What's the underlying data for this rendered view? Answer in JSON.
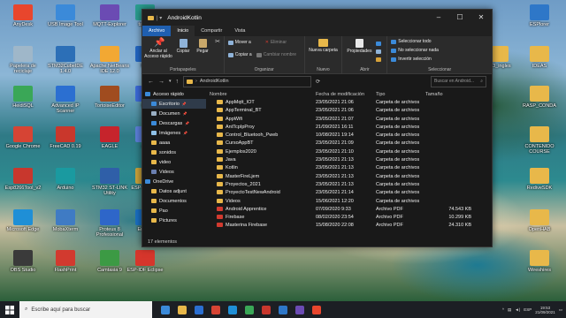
{
  "desktop": {
    "icons": [
      {
        "label": "AnyDesk",
        "color": "#e8462d"
      },
      {
        "label": "USB Image Tool",
        "color": "#3b8ad9"
      },
      {
        "label": "MQTT-Explorer",
        "color": "#6b4bb3"
      },
      {
        "label": "tasmo",
        "color": "#2a9d8f"
      },
      {
        "label": "Papelera de reciclaje",
        "color": "#9fb7c9"
      },
      {
        "label": "STM32CubeIDE 1.4.0",
        "color": "#2c6fb7"
      },
      {
        "label": "Apache NetBeans IDE 12.0",
        "color": "#f2a833"
      },
      {
        "label": "Mic",
        "color": "#2367c4"
      },
      {
        "label": "HeidiSQL",
        "color": "#3aa757"
      },
      {
        "label": "Advanced IP Scanner",
        "color": "#2b6fd1"
      },
      {
        "label": "TortoiseEditor",
        "color": "#a04c1f"
      },
      {
        "label": "CC",
        "color": "#3b6ad9"
      },
      {
        "label": "Google Chrome",
        "color": "#d64434"
      },
      {
        "label": "FreeCAD 0.19",
        "color": "#c9372c"
      },
      {
        "label": "EAGLE",
        "color": "#c6242c"
      },
      {
        "label": "AC",
        "color": "#5b7fd8"
      },
      {
        "label": "Esp8266Tool_v2",
        "color": "#c8372d"
      },
      {
        "label": "Arduino",
        "color": "#1a9aa0"
      },
      {
        "label": "STM32 ST-LINK Utility",
        "color": "#2f5fa8"
      },
      {
        "label": "ESP-Downlo",
        "color": "#c9a23a"
      },
      {
        "label": "Microsoft Edge",
        "color": "#1f8fd6"
      },
      {
        "label": "MobaXterm",
        "color": "#3f7bc4"
      },
      {
        "label": "Proteus 8 Professional",
        "color": "#2e66c9"
      },
      {
        "label": "Ensam",
        "color": "#1a6fc2"
      },
      {
        "label": "OBS Studio",
        "color": "#3a3a3a"
      },
      {
        "label": "FlashPrint",
        "color": "#d23a2f"
      },
      {
        "label": "Camtasia 9",
        "color": "#3c9a44"
      },
      {
        "label": "ESP-IDF Eclipse",
        "color": "#d6362c"
      },
      {
        "label": "ESPlorer",
        "color": "#2e77c8"
      },
      {
        "label": "Ap3_ingles",
        "color": "#e8b84a"
      },
      {
        "label": "IDEAS",
        "color": "#e8b84a"
      },
      {
        "label": "RASP_CONDA",
        "color": "#e8b84a"
      },
      {
        "label": "CONTENIDO COURSE",
        "color": "#e8b84a"
      },
      {
        "label": "RediveSDK",
        "color": "#e8b84a"
      },
      {
        "label": "OpenHAB",
        "color": "#e8b84a"
      },
      {
        "label": "Wireshires",
        "color": "#e8b84a"
      }
    ]
  },
  "window": {
    "title": "AndroidKotlin",
    "tabs": [
      "Archivo",
      "Inicio",
      "Compartir",
      "Vista"
    ],
    "ribbon": {
      "pin_label": "Anclar al Acceso rápido",
      "copy_label": "Copiar",
      "paste_label": "Pegar",
      "cut_label": "",
      "group_portapapeles": "Portapapeles",
      "move_to": "Mover a",
      "copy_to": "Copiar a",
      "delete": "Eliminar",
      "rename": "Cambiar nombre",
      "group_organizar": "Organizar",
      "new_folder": "Nueva carpeta",
      "group_nuevo": "Nuevo",
      "properties": "Propiedades",
      "group_abrir": "Abrir",
      "select_all": "Seleccionar todo",
      "select_none": "No seleccionar nada",
      "invert_selection": "Invertir selección",
      "group_seleccionar": "Seleccionar"
    },
    "address": {
      "path": "AndroidKotlin",
      "search_placeholder": "Buscar en Android..."
    },
    "nav": [
      {
        "label": "Acceso rápido",
        "color": "#3b8ad9",
        "pin": false
      },
      {
        "label": "Escritorio",
        "color": "#3b8ad9",
        "pin": true
      },
      {
        "label": "Documen",
        "color": "#9bb0c4",
        "pin": true
      },
      {
        "label": "Descargas",
        "color": "#3b8ad9",
        "pin": true
      },
      {
        "label": "Imágenes",
        "color": "#8fc1e8",
        "pin": true
      },
      {
        "label": "aaaa",
        "color": "#e8b84a",
        "pin": false
      },
      {
        "label": "sonidos",
        "color": "#e8b84a",
        "pin": false
      },
      {
        "label": "video",
        "color": "#e8b84a",
        "pin": false
      },
      {
        "label": "Videos",
        "color": "#6a7fb0",
        "pin": false
      },
      {
        "label": "OneDrive",
        "color": "#3b8ad9",
        "pin": false
      },
      {
        "label": "Datos adjunt",
        "color": "#e8b84a",
        "pin": false
      },
      {
        "label": "Documentos",
        "color": "#e8b84a",
        "pin": false
      },
      {
        "label": "Pao",
        "color": "#e8b84a",
        "pin": false
      },
      {
        "label": "Pictures",
        "color": "#e8b84a",
        "pin": false
      }
    ],
    "columns": {
      "name": "Nombre",
      "date": "Fecha de modificación",
      "type": "Tipo",
      "size": "Tamaño"
    },
    "files": [
      {
        "name": "AppMqtt_IOT",
        "date": "23/05/2021 21:06",
        "type": "Carpeta de archivos",
        "size": "",
        "color": "#e8b84a"
      },
      {
        "name": "AppTerminal_BT",
        "date": "23/05/2021 21:06",
        "type": "Carpeta de archivos",
        "size": "",
        "color": "#e8b84a"
      },
      {
        "name": "AppWifi",
        "date": "23/05/2021 21:07",
        "type": "Carpeta de archivos",
        "size": "",
        "color": "#e8b84a"
      },
      {
        "name": "AntTcpIpProy",
        "date": "21/09/2021 16:11",
        "type": "Carpeta de archivos",
        "size": "",
        "color": "#e8b84a"
      },
      {
        "name": "Control_Bluetooh_Pweb",
        "date": "10/08/2021 19:14",
        "type": "Carpeta de archivos",
        "size": "",
        "color": "#e8b84a"
      },
      {
        "name": "CursoAppBT",
        "date": "23/05/2021 21:09",
        "type": "Carpeta de archivos",
        "size": "",
        "color": "#e8b84a"
      },
      {
        "name": "Ejemplos2020",
        "date": "23/05/2021 21:10",
        "type": "Carpeta de archivos",
        "size": "",
        "color": "#e8b84a"
      },
      {
        "name": "Java",
        "date": "23/05/2021 21:13",
        "type": "Carpeta de archivos",
        "size": "",
        "color": "#e8b84a"
      },
      {
        "name": "Kotlin",
        "date": "23/05/2021 21:13",
        "type": "Carpeta de archivos",
        "size": "",
        "color": "#e8b84a"
      },
      {
        "name": "MasterFireLjem",
        "date": "23/05/2021 21:13",
        "type": "Carpeta de archivos",
        "size": "",
        "color": "#e8b84a"
      },
      {
        "name": "Proyectos_2021",
        "date": "23/05/2021 21:13",
        "type": "Carpeta de archivos",
        "size": "",
        "color": "#e8b84a"
      },
      {
        "name": "ProyectoTestNewAndroid",
        "date": "23/05/2021 21:14",
        "type": "Carpeta de archivos",
        "size": "",
        "color": "#e8b84a"
      },
      {
        "name": "Videos",
        "date": "15/06/2021 12:20",
        "type": "Carpeta de archivos",
        "size": "",
        "color": "#e8b84a"
      },
      {
        "name": "Android Apprentice",
        "date": "07/09/2020 9:33",
        "type": "Archivo PDF",
        "size": "74.543 KB",
        "color": "#d23a2f"
      },
      {
        "name": "Firebase",
        "date": "08/02/2020 23:54",
        "type": "Archivo PDF",
        "size": "10.299 KB",
        "color": "#d23a2f"
      },
      {
        "name": "Masterina Firebase",
        "date": "15/08/2020 22:08",
        "type": "Archivo PDF",
        "size": "24.310 KB",
        "color": "#d23a2f"
      }
    ],
    "status": "17 elementos"
  },
  "taskbar": {
    "search_placeholder": "Escribe aquí para buscar",
    "apps": [
      "#3b8ad9",
      "#e8b84a",
      "#2b6fd1",
      "#d64434",
      "#1f8fd6",
      "#3aa757",
      "#c8372d",
      "#2e77c8",
      "#6b4bb3",
      "#e8462d"
    ],
    "tray_text": "ESP",
    "time": "19:53",
    "date": "21/09/2021"
  }
}
